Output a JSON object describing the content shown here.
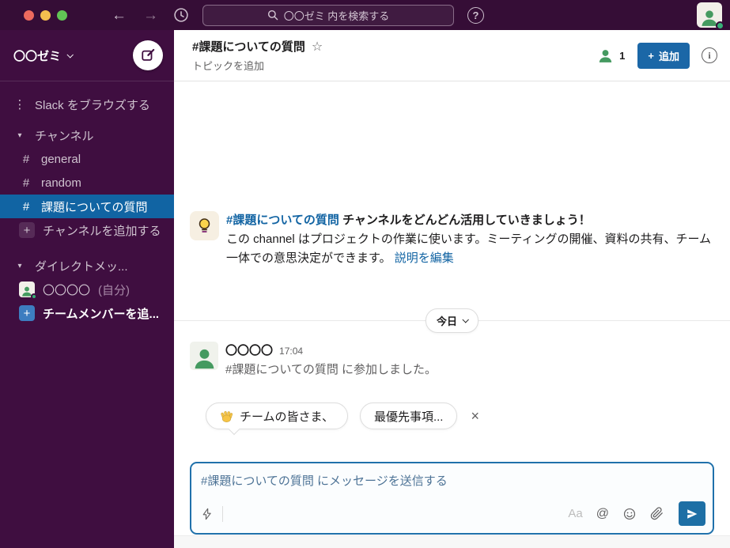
{
  "colors": {
    "topbar_bg": "#350d36",
    "sidebar_bg": "#3f0e40",
    "active_item_bg": "#1164a3",
    "link_blue": "#1264a3",
    "button_blue": "#1b67a7",
    "send_button_blue": "#1d6fa5",
    "avatar_green": "#459a60",
    "presence_green": "#37b077"
  },
  "glyphs": {
    "back_arrow": "←",
    "forward_arrow": "→",
    "question": "?",
    "info": "i",
    "dots": "⋮",
    "tri_down": "▾",
    "plus": "+",
    "star": "☆",
    "close": "×",
    "at": "@"
  },
  "topbar": {
    "search_placeholder": "〇〇ゼミ 内を検索する"
  },
  "sidebar": {
    "workspace_name": "〇〇ゼミ",
    "browse_label": "Slack をブラウズする",
    "channels_section_label": "チャンネル",
    "channel_prefix": "#",
    "channels": [
      {
        "name": "general"
      },
      {
        "name": "random"
      },
      {
        "name": "課題についての質問"
      }
    ],
    "add_channel_label": "チャンネルを追加する",
    "dm_section_label": "ダイレクトメッ...",
    "dm_user_name": "〇〇〇〇",
    "dm_user_suffix": "(自分)",
    "add_teammates_label": "チームメンバーを追..."
  },
  "channel_header": {
    "title": "#課題についての質問",
    "topic_placeholder": "トピックを追加",
    "member_count": "1",
    "add_button_label": "追加"
  },
  "welcome": {
    "icon": "lightbulb",
    "channel_link": "#課題についての質問",
    "title_rest": " チャンネルをどんどん活用していきましょう！",
    "body": "この channel はプロジェクトの作業に使います。ミーティングの開催、資料の共有、チーム一体での意思決定ができます。",
    "edit_link": "説明を編集"
  },
  "date_divider": {
    "label": "今日"
  },
  "messages": [
    {
      "author": "〇〇〇〇",
      "time": "17:04",
      "text": "#課題についての質問 に参加しました。"
    }
  ],
  "suggestions": {
    "chips": [
      {
        "icon": "wave-hand",
        "label": "チームの皆さま、"
      },
      {
        "icon": "",
        "label": "最優先事項..."
      }
    ]
  },
  "composer": {
    "placeholder": "#課題についての質問 にメッセージを送信する",
    "format_label": "Aa"
  }
}
